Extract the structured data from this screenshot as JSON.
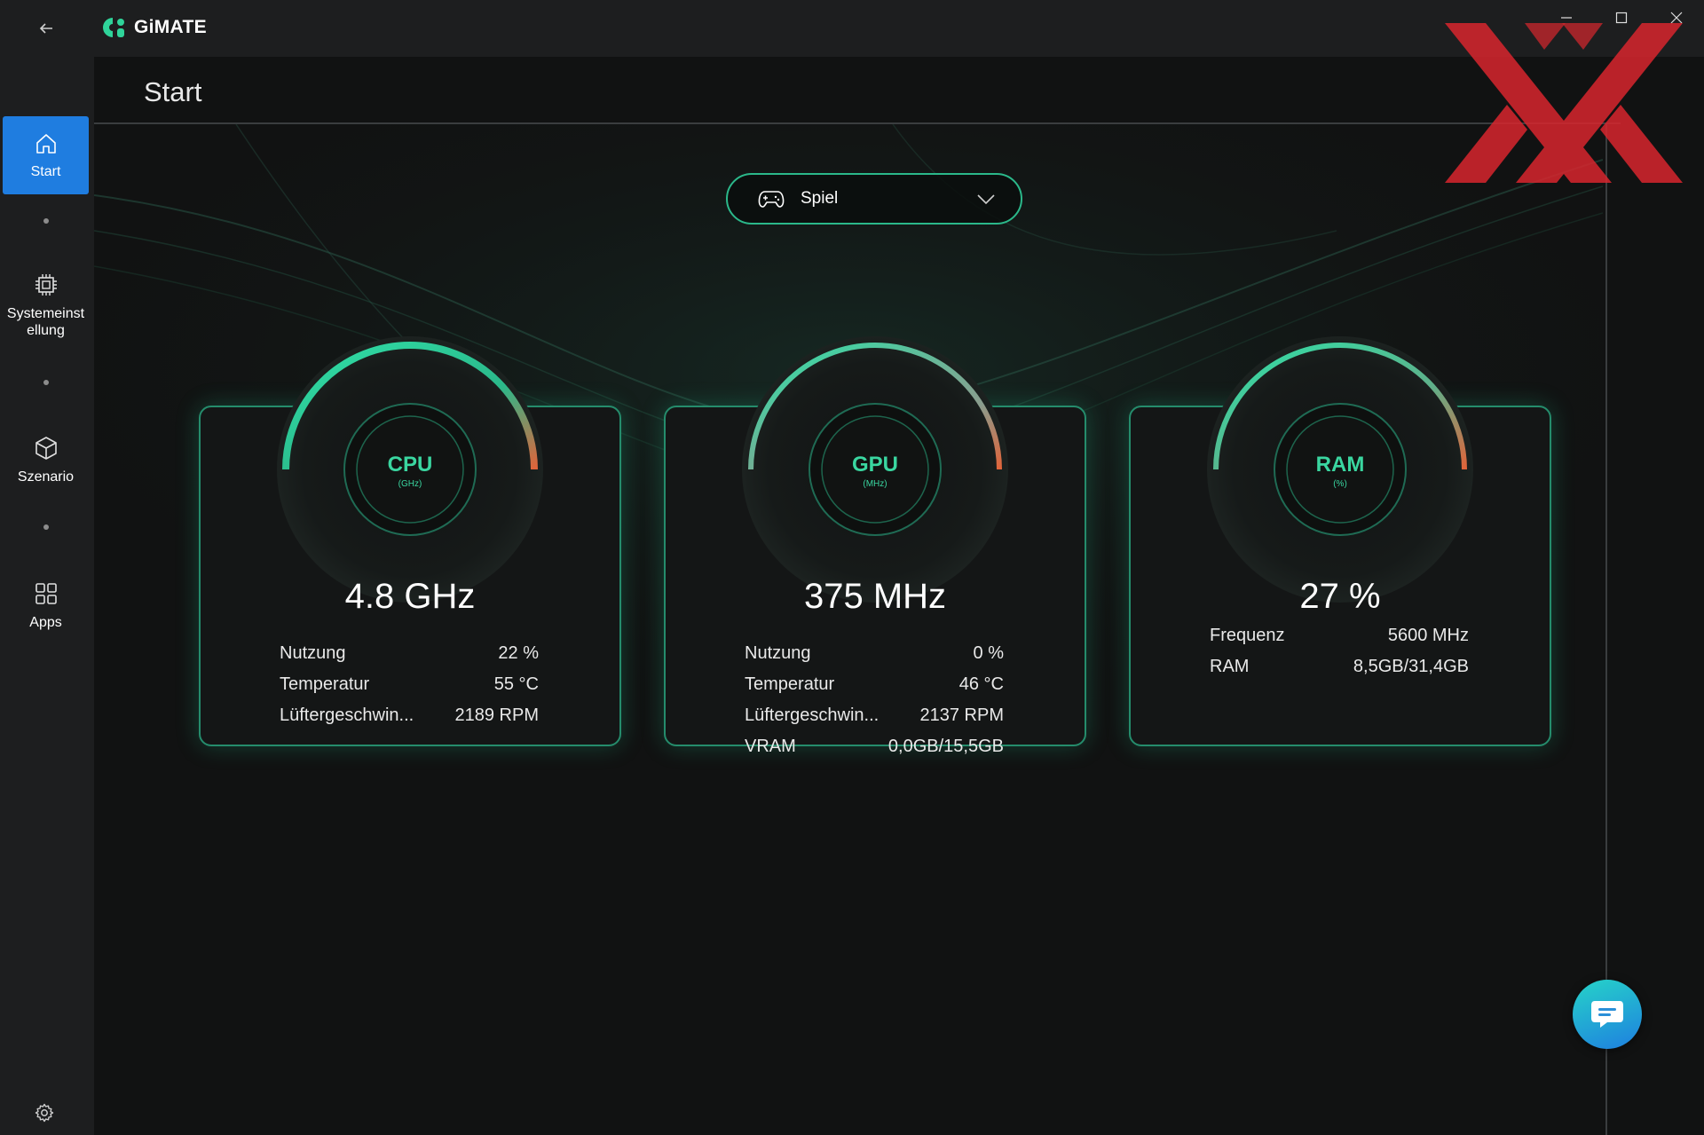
{
  "app": {
    "name": "GiMATE",
    "accent_color": "#1f7de0",
    "glow_color": "#2bb88a"
  },
  "titlebar": {
    "back_icon": "arrow-left-icon",
    "minimize_icon": "minimize-icon",
    "maximize_icon": "maximize-icon",
    "close_icon": "close-icon"
  },
  "sidebar": {
    "items": [
      {
        "label": "Start",
        "icon": "home-icon",
        "active": true
      },
      {
        "label": "Systemeinst ellung",
        "icon": "chip-icon",
        "active": false
      },
      {
        "label": "Szenario",
        "icon": "cube-icon",
        "active": false
      },
      {
        "label": "Apps",
        "icon": "apps-grid-icon",
        "active": false
      }
    ],
    "settings_icon": "gear-icon"
  },
  "main": {
    "title": "Start",
    "mode_dropdown": {
      "selected": "Spiel",
      "icon": "gamepad-icon"
    },
    "cards": [
      {
        "gauge_title": "CPU",
        "gauge_unit": "(GHz)",
        "value": "4.8 GHz",
        "stats": [
          {
            "label": "Nutzung",
            "value": "22 %"
          },
          {
            "label": "Temperatur",
            "value": "55 °C"
          },
          {
            "label": "Lüftergeschwin...",
            "value": "2189 RPM"
          }
        ]
      },
      {
        "gauge_title": "GPU",
        "gauge_unit": "(MHz)",
        "value": "375 MHz",
        "stats": [
          {
            "label": "Nutzung",
            "value": "0 %"
          },
          {
            "label": "Temperatur",
            "value": "46 °C"
          },
          {
            "label": "Lüftergeschwin...",
            "value": "2137 RPM"
          },
          {
            "label": "VRAM",
            "value": "0,0GB/15,5GB"
          }
        ]
      },
      {
        "gauge_title": "RAM",
        "gauge_unit": "(%)",
        "value": "27 %",
        "stats": [
          {
            "label": "Frequenz",
            "value": "5600 MHz"
          },
          {
            "label": "RAM",
            "value": "8,5GB/31,4GB"
          }
        ]
      }
    ]
  },
  "chat": {
    "icon": "chat-bubble-icon"
  },
  "watermark": {
    "icon": "xx-logo-icon",
    "color": "#d8262e"
  }
}
